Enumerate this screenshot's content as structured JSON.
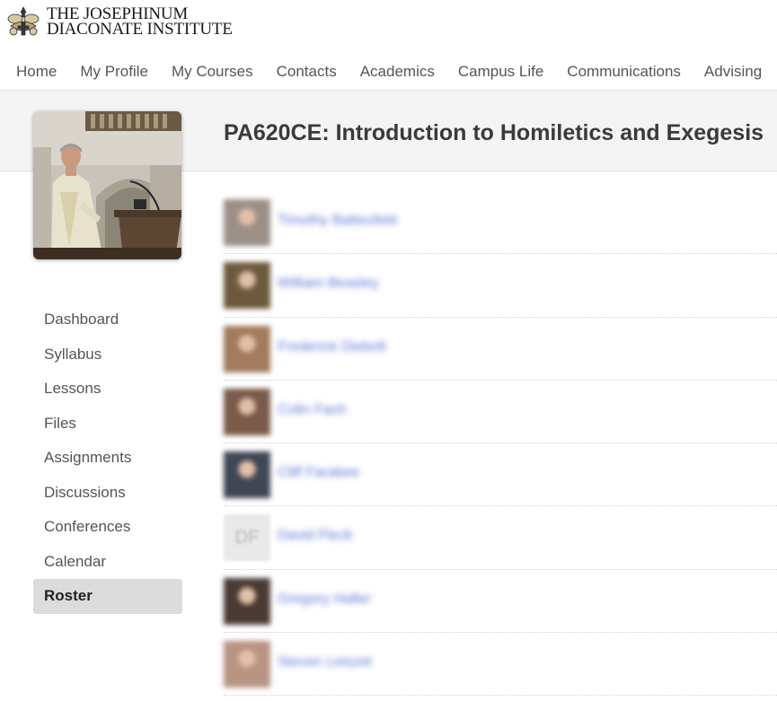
{
  "brand": {
    "line1": "THE JOSEPHINUM",
    "line2": "DIACONATE INSTITUTE"
  },
  "nav": {
    "items": [
      {
        "label": "Home"
      },
      {
        "label": "My Profile"
      },
      {
        "label": "My Courses"
      },
      {
        "label": "Contacts"
      },
      {
        "label": "Academics"
      },
      {
        "label": "Campus Life"
      },
      {
        "label": "Communications"
      },
      {
        "label": "Advising"
      }
    ]
  },
  "course": {
    "title": "PA620CE: Introduction to Homiletics and Exegesis"
  },
  "sidebar": {
    "items": [
      {
        "label": "Dashboard",
        "active": false
      },
      {
        "label": "Syllabus",
        "active": false
      },
      {
        "label": "Lessons",
        "active": false
      },
      {
        "label": "Files",
        "active": false
      },
      {
        "label": "Assignments",
        "active": false
      },
      {
        "label": "Discussions",
        "active": false
      },
      {
        "label": "Conferences",
        "active": false
      },
      {
        "label": "Calendar",
        "active": false
      },
      {
        "label": "Roster",
        "active": true
      }
    ]
  },
  "roster": {
    "members": [
      {
        "name": "Timothy Batteufeld",
        "avatar_color": "#9b8f86"
      },
      {
        "name": "William Beasley",
        "avatar_color": "#6d5a3c"
      },
      {
        "name": "Frederick Diebolt",
        "avatar_color": "#a27a5c"
      },
      {
        "name": "Colin Fach",
        "avatar_color": "#7a5a48"
      },
      {
        "name": "Cliff Farabee",
        "avatar_color": "#3f4654"
      },
      {
        "name": "David Fleck",
        "initials": "DF"
      },
      {
        "name": "Gregory Haller",
        "avatar_color": "#4a3a34"
      },
      {
        "name": "Steven Leiszet",
        "avatar_color": "#b89482"
      }
    ]
  },
  "colors": {
    "link": "#5b74d6",
    "active_bg": "#dcdcdc",
    "band_bg": "#f4f4f4"
  }
}
